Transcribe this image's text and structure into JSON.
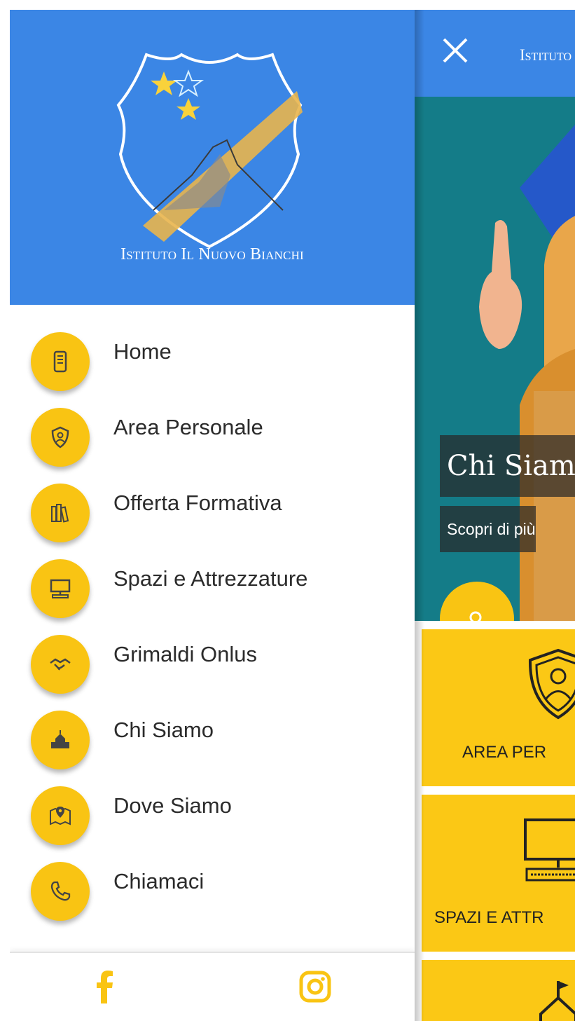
{
  "drawer": {
    "crest_text": "Il Bianchi",
    "brand_name": "Istituto Il Nuovo Bianchi",
    "menu": [
      {
        "label": "Home",
        "icon": "phone-device-icon"
      },
      {
        "label": "Area Personale",
        "icon": "shield-person-icon"
      },
      {
        "label": "Offerta Formativa",
        "icon": "books-icon"
      },
      {
        "label": "Spazi e Attrezzature",
        "icon": "computer-icon"
      },
      {
        "label": "Grimaldi Onlus",
        "icon": "handshake-icon"
      },
      {
        "label": "Chi Siamo",
        "icon": "building-icon"
      },
      {
        "label": "Dove Siamo",
        "icon": "map-pin-icon"
      },
      {
        "label": "Chiamaci",
        "icon": "phone-icon"
      }
    ],
    "footer": {
      "facebook_icon": "facebook-icon",
      "instagram_icon": "instagram-icon"
    }
  },
  "main": {
    "topbar_title": "Istituto",
    "hero": {
      "title": "Chi Siam",
      "subtitle": "Scopri di più"
    },
    "tiles": [
      {
        "label": "AREA PER",
        "icon": "shield-person-icon"
      },
      {
        "label": "SPAZI E ATTR",
        "icon": "computer-icon"
      },
      {
        "label": "",
        "icon": "building-icon"
      }
    ]
  },
  "colors": {
    "primary_blue": "#3b86e5",
    "accent_yellow": "#f9c413",
    "hero_teal": "#147c88"
  }
}
